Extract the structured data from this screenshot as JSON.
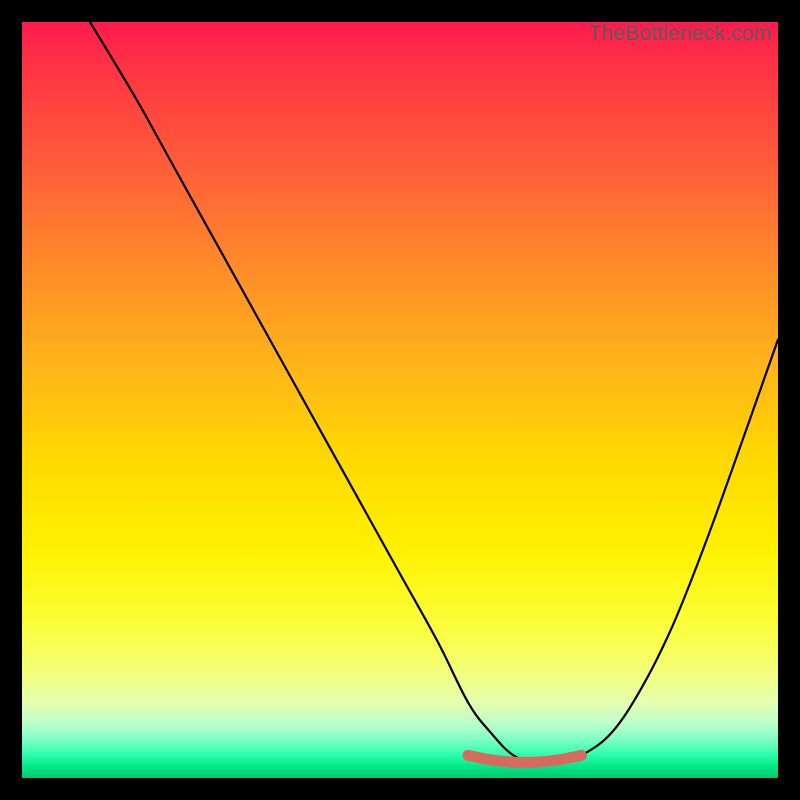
{
  "watermark": "TheBottleneck.com",
  "chart_data": {
    "type": "line",
    "title": "",
    "xlabel": "",
    "ylabel": "",
    "xlim": [
      0,
      100
    ],
    "ylim": [
      0,
      100
    ],
    "grid": false,
    "series": [
      {
        "name": "curve",
        "x": [
          9,
          15,
          20,
          25,
          30,
          35,
          40,
          45,
          50,
          55,
          59,
          62,
          65,
          68,
          71,
          74,
          78,
          82,
          86,
          90,
          94,
          100
        ],
        "y": [
          100,
          90,
          81,
          72,
          63,
          54,
          45,
          36,
          27,
          18,
          10,
          6,
          3,
          2,
          2,
          3,
          6,
          12,
          20,
          30,
          41,
          58
        ]
      },
      {
        "name": "flat-marker",
        "x": [
          59,
          62,
          65,
          68,
          71,
          74
        ],
        "y": [
          3.0,
          2.4,
          2.1,
          2.1,
          2.4,
          3.0
        ]
      }
    ],
    "colors": {
      "curve": "#000000",
      "flat_marker": "#d66a5f",
      "gradient_top": "#ff1a4d",
      "gradient_bottom": "#00c86f"
    }
  }
}
